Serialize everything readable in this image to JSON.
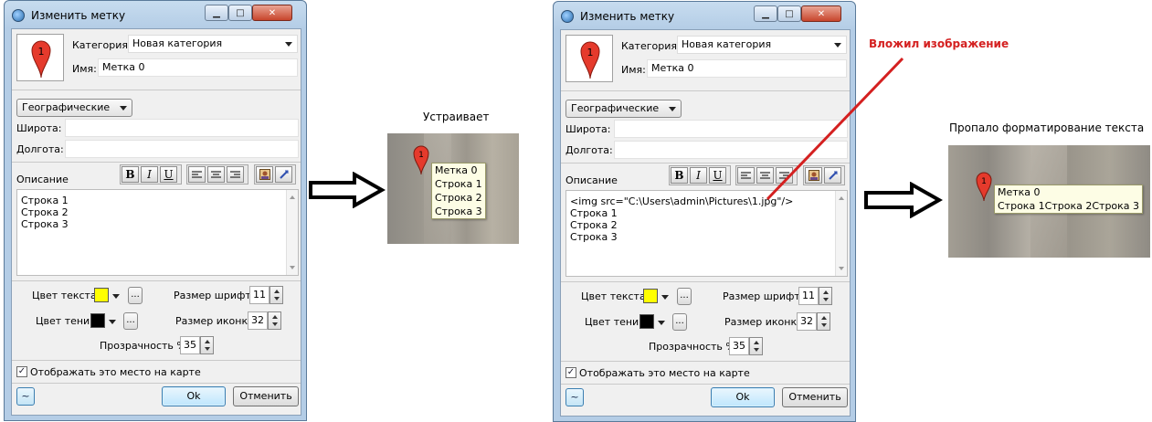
{
  "dialog_left": {
    "title": "Изменить метку",
    "category_label": "Категория:",
    "category_value": "Новая категория",
    "name_label": "Имя:",
    "name_value": "Метка 0",
    "coord_mode": "Географические",
    "latitude_label": "Широта:",
    "longitude_label": "Долгота:",
    "description_label": "Описание",
    "description_lines": [
      "Строка 1",
      "Строка 2",
      "Строка 3"
    ],
    "text_color_label": "Цвет текста",
    "text_color": "#ffff00",
    "shadow_color_label": "Цвет тени",
    "shadow_color": "#000000",
    "font_size_label": "Размер шрифта",
    "font_size": "11",
    "icon_size_label": "Размер иконки",
    "icon_size": "32",
    "opacity_label": "Прозрачность %",
    "opacity": "35",
    "show_on_map_label": "Отображать это место на карте",
    "show_on_map": true,
    "ok_label": "Ok",
    "cancel_label": "Отменить",
    "tilde": "~",
    "dots": "..."
  },
  "dialog_right": {
    "title": "Изменить метку",
    "category_label": "Категория:",
    "category_value": "Новая категория",
    "name_label": "Имя:",
    "name_value": "Метка 0",
    "coord_mode": "Географические",
    "latitude_label": "Широта:",
    "longitude_label": "Долгота:",
    "description_label": "Описание",
    "description_lines": [
      "<img src=\"C:\\Users\\admin\\Pictures\\1.jpg\"/>",
      "Строка 1",
      "Строка 2",
      "Строка 3"
    ],
    "text_color_label": "Цвет текста",
    "text_color": "#ffff00",
    "shadow_color_label": "Цвет тени",
    "shadow_color": "#000000",
    "font_size_label": "Размер шрифта",
    "font_size": "11",
    "icon_size_label": "Размер иконки",
    "icon_size": "32",
    "opacity_label": "Прозрачность %",
    "opacity": "35",
    "show_on_map_label": "Отображать это место на карте",
    "show_on_map": true,
    "ok_label": "Ok",
    "cancel_label": "Отменить",
    "tilde": "~",
    "dots": "..."
  },
  "toolbar_glyphs": {
    "bold": "B",
    "italic": "I",
    "underline": "U"
  },
  "pin_number": "1",
  "caption_ok": "Устраивает",
  "preview_ok_lines": [
    "Метка 0",
    "Строка 1",
    "Строка 2",
    "Строка 3"
  ],
  "annotation_inserted": "Вложил изображение",
  "annotation_color": "#d42020",
  "caption_lost": "Пропало форматирование текста",
  "preview_lost_lines": [
    "Метка 0",
    "Строка 1Строка 2Строка 3"
  ],
  "icons": [
    "app-icon",
    "minimize-icon",
    "maximize-icon",
    "close-icon",
    "map-pin-icon",
    "bold-icon",
    "italic-icon",
    "underline-icon",
    "align-left-icon",
    "align-center-icon",
    "align-right-icon",
    "insert-image-icon",
    "link-icon",
    "arrow-right-icon"
  ]
}
